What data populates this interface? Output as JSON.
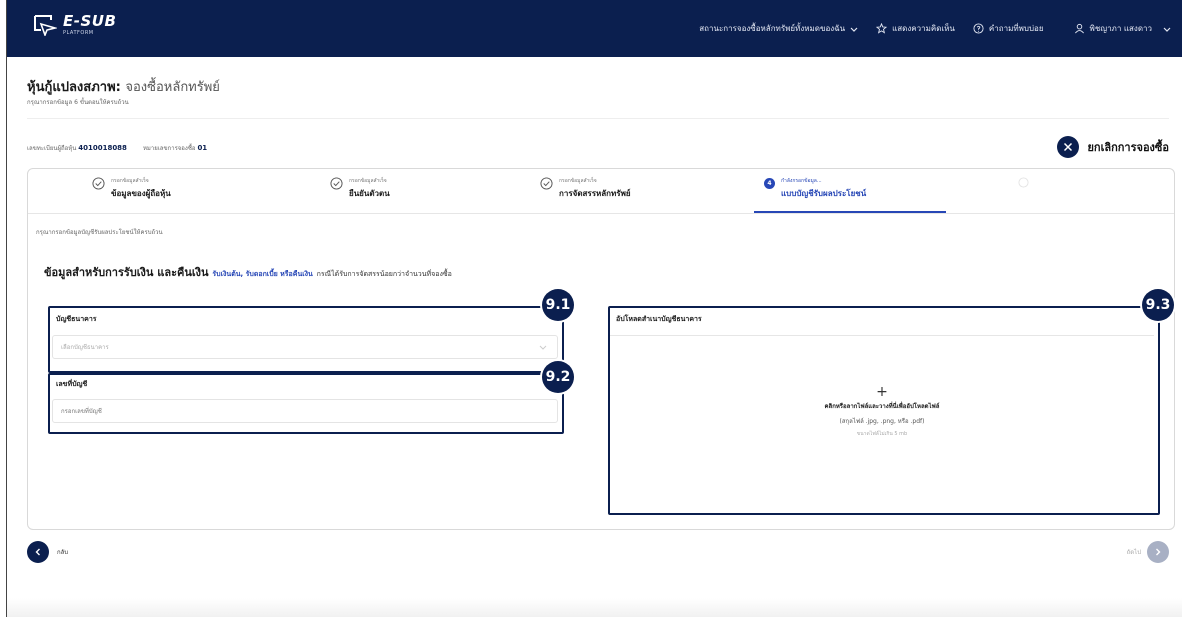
{
  "brand": {
    "name": "E-SUB",
    "tagline": "PLATFORM"
  },
  "navbar": {
    "status_link": "สถานะการจองซื้อหลักทรัพย์ทั้งหมดของฉัน",
    "feedback": "แสดงความคิดเห็น",
    "help": "คำถามที่พบบ่อย",
    "user": "พิชญาภา แสงดาว"
  },
  "header": {
    "title": "หุ้นกู้แปลงสภาพ:",
    "title_sub": "จองซื้อหลักทรัพย์",
    "subtitle": "กรุณากรอกข้อมูล 6 ขั้นตอนให้ครบถ้วน"
  },
  "account": {
    "holder_label": "เลขทะเบียนผู้ถือหุ้น",
    "holder_value": "4010018088",
    "order_label": "หมายเลขการจองซื้อ",
    "order_value": "01"
  },
  "cancel_label": "ยกเลิกการจองซื้อ",
  "steps": [
    {
      "small": "กรอกข้อมูลสำเร็จ",
      "big": "ข้อมูลของผู้ถือหุ้น"
    },
    {
      "small": "กรอกข้อมูลสำเร็จ",
      "big": "ยืนยันตัวตน"
    },
    {
      "small": "กรอกข้อมูลสำเร็จ",
      "big": "การจัดสรรหลักทรัพย์"
    },
    {
      "num": "4",
      "small": "กำลังกรอกข้อมูล...",
      "big": "แบบบัญชีรับผลประโยชน์"
    },
    {
      "small": "",
      "big": ""
    }
  ],
  "card_hint": "กรุณากรอกข้อมูลบัญชีรับผลประโยชน์ให้ครบถ้วน",
  "section": {
    "title": "ข้อมูลสำหรับการรับเงิน และคืนเงิน",
    "highlight": "รับเงินต้น, รับดอกเบี้ย หรือคืนเงิน",
    "rest": "กรณีได้รับการจัดสรรน้อยกว่าจำนวนที่จองซื้อ"
  },
  "bank_account": {
    "label": "บัญชีธนาคาร",
    "placeholder": "เลือกบัญชีธนาคาร"
  },
  "account_number": {
    "label": "เลขที่บัญชี",
    "placeholder": "กรอกเลขที่บัญชี"
  },
  "upload": {
    "label": "อัปโหลดสำเนาบัญชีธนาคาร",
    "plus": "+",
    "line1": "คลิกหรือลากไฟล์และวางที่นี่เพื่ออัปโหลดไฟล์",
    "line2": "(สกุลไฟล์ .jpg, .png, หรือ .pdf)",
    "line3": "ขนาดไฟล์ไม่เกิน 5 mb"
  },
  "markers": {
    "m1": "9.1",
    "m2": "9.2",
    "m3": "9.3"
  },
  "footer": {
    "back": "กลับ",
    "next": "ถัดไป"
  },
  "colors": {
    "navy": "#0b1f4f",
    "accent": "#2747b6"
  }
}
